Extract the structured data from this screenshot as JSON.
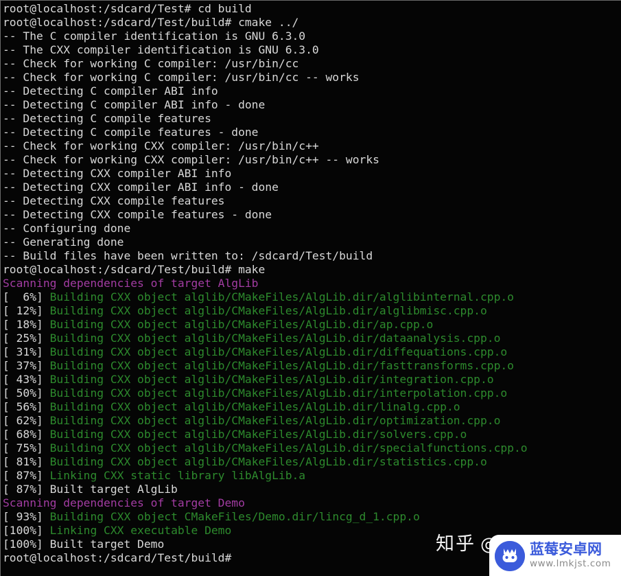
{
  "terminal": {
    "title": "root@localhost:/sdcard/Test/build",
    "colors": {
      "background": "#050505",
      "foreground": "#d8d8d8",
      "green": "#2d8a2d",
      "magenta": "#a23ca2",
      "border": "#6a6a6a"
    },
    "lines": [
      {
        "segments": [
          {
            "text": "root@localhost:/sdcard/Test# cd build",
            "color": "white"
          }
        ]
      },
      {
        "segments": [
          {
            "text": "root@localhost:/sdcard/Test/build# cmake ../",
            "color": "white"
          }
        ]
      },
      {
        "segments": [
          {
            "text": "-- The C compiler identification is GNU 6.3.0",
            "color": "white"
          }
        ]
      },
      {
        "segments": [
          {
            "text": "-- The CXX compiler identification is GNU 6.3.0",
            "color": "white"
          }
        ]
      },
      {
        "segments": [
          {
            "text": "-- Check for working C compiler: /usr/bin/cc",
            "color": "white"
          }
        ]
      },
      {
        "segments": [
          {
            "text": "-- Check for working C compiler: /usr/bin/cc -- works",
            "color": "white"
          }
        ]
      },
      {
        "segments": [
          {
            "text": "-- Detecting C compiler ABI info",
            "color": "white"
          }
        ]
      },
      {
        "segments": [
          {
            "text": "-- Detecting C compiler ABI info - done",
            "color": "white"
          }
        ]
      },
      {
        "segments": [
          {
            "text": "-- Detecting C compile features",
            "color": "white"
          }
        ]
      },
      {
        "segments": [
          {
            "text": "-- Detecting C compile features - done",
            "color": "white"
          }
        ]
      },
      {
        "segments": [
          {
            "text": "-- Check for working CXX compiler: /usr/bin/c++",
            "color": "white"
          }
        ]
      },
      {
        "segments": [
          {
            "text": "-- Check for working CXX compiler: /usr/bin/c++ -- works",
            "color": "white"
          }
        ]
      },
      {
        "segments": [
          {
            "text": "-- Detecting CXX compiler ABI info",
            "color": "white"
          }
        ]
      },
      {
        "segments": [
          {
            "text": "-- Detecting CXX compiler ABI info - done",
            "color": "white"
          }
        ]
      },
      {
        "segments": [
          {
            "text": "-- Detecting CXX compile features",
            "color": "white"
          }
        ]
      },
      {
        "segments": [
          {
            "text": "-- Detecting CXX compile features - done",
            "color": "white"
          }
        ]
      },
      {
        "segments": [
          {
            "text": "-- Configuring done",
            "color": "white"
          }
        ]
      },
      {
        "segments": [
          {
            "text": "-- Generating done",
            "color": "white"
          }
        ]
      },
      {
        "segments": [
          {
            "text": "-- Build files have been written to: /sdcard/Test/build",
            "color": "white"
          }
        ]
      },
      {
        "segments": [
          {
            "text": "root@localhost:/sdcard/Test/build# make",
            "color": "white"
          }
        ]
      },
      {
        "segments": [
          {
            "text": "Scanning dependencies of target AlgLib",
            "color": "magenta"
          }
        ]
      },
      {
        "segments": [
          {
            "text": "[  6%] ",
            "color": "white"
          },
          {
            "text": "Building CXX object alglib/CMakeFiles/AlgLib.dir/alglibinternal.cpp.o",
            "color": "green"
          }
        ]
      },
      {
        "segments": [
          {
            "text": "[ 12%] ",
            "color": "white"
          },
          {
            "text": "Building CXX object alglib/CMakeFiles/AlgLib.dir/alglibmisc.cpp.o",
            "color": "green"
          }
        ]
      },
      {
        "segments": [
          {
            "text": "[ 18%] ",
            "color": "white"
          },
          {
            "text": "Building CXX object alglib/CMakeFiles/AlgLib.dir/ap.cpp.o",
            "color": "green"
          }
        ]
      },
      {
        "segments": [
          {
            "text": "[ 25%] ",
            "color": "white"
          },
          {
            "text": "Building CXX object alglib/CMakeFiles/AlgLib.dir/dataanalysis.cpp.o",
            "color": "green"
          }
        ]
      },
      {
        "segments": [
          {
            "text": "[ 31%] ",
            "color": "white"
          },
          {
            "text": "Building CXX object alglib/CMakeFiles/AlgLib.dir/diffequations.cpp.o",
            "color": "green"
          }
        ]
      },
      {
        "segments": [
          {
            "text": "[ 37%] ",
            "color": "white"
          },
          {
            "text": "Building CXX object alglib/CMakeFiles/AlgLib.dir/fasttransforms.cpp.o",
            "color": "green"
          }
        ]
      },
      {
        "segments": [
          {
            "text": "[ 43%] ",
            "color": "white"
          },
          {
            "text": "Building CXX object alglib/CMakeFiles/AlgLib.dir/integration.cpp.o",
            "color": "green"
          }
        ]
      },
      {
        "segments": [
          {
            "text": "[ 50%] ",
            "color": "white"
          },
          {
            "text": "Building CXX object alglib/CMakeFiles/AlgLib.dir/interpolation.cpp.o",
            "color": "green"
          }
        ]
      },
      {
        "segments": [
          {
            "text": "[ 56%] ",
            "color": "white"
          },
          {
            "text": "Building CXX object alglib/CMakeFiles/AlgLib.dir/linalg.cpp.o",
            "color": "green"
          }
        ]
      },
      {
        "segments": [
          {
            "text": "[ 62%] ",
            "color": "white"
          },
          {
            "text": "Building CXX object alglib/CMakeFiles/AlgLib.dir/optimization.cpp.o",
            "color": "green"
          }
        ]
      },
      {
        "segments": [
          {
            "text": "[ 68%] ",
            "color": "white"
          },
          {
            "text": "Building CXX object alglib/CMakeFiles/AlgLib.dir/solvers.cpp.o",
            "color": "green"
          }
        ]
      },
      {
        "segments": [
          {
            "text": "[ 75%] ",
            "color": "white"
          },
          {
            "text": "Building CXX object alglib/CMakeFiles/AlgLib.dir/specialfunctions.cpp.o",
            "color": "green"
          }
        ]
      },
      {
        "segments": [
          {
            "text": "[ 81%] ",
            "color": "white"
          },
          {
            "text": "Building CXX object alglib/CMakeFiles/AlgLib.dir/statistics.cpp.o",
            "color": "green"
          }
        ]
      },
      {
        "segments": [
          {
            "text": "[ 87%] ",
            "color": "white"
          },
          {
            "text": "Linking CXX static library libAlgLib.a",
            "color": "green"
          }
        ]
      },
      {
        "segments": [
          {
            "text": "[ 87%] Built target AlgLib",
            "color": "white"
          }
        ]
      },
      {
        "segments": [
          {
            "text": "Scanning dependencies of target Demo",
            "color": "magenta"
          }
        ]
      },
      {
        "segments": [
          {
            "text": "[ 93%] ",
            "color": "white"
          },
          {
            "text": "Building CXX object CMakeFiles/Demo.dir/lincg_d_1.cpp.o",
            "color": "green"
          }
        ]
      },
      {
        "segments": [
          {
            "text": "[100%] ",
            "color": "white"
          },
          {
            "text": "Linking CXX executable Demo",
            "color": "green"
          }
        ]
      },
      {
        "segments": [
          {
            "text": "[100%] Built target Demo",
            "color": "white"
          }
        ]
      },
      {
        "segments": [
          {
            "text": "root@localhost:/sdcard/Test/build#",
            "color": "white"
          }
        ]
      }
    ]
  },
  "watermarks": {
    "zhihu": {
      "label": "知乎",
      "at_symbol": "@"
    },
    "site": {
      "name": "蓝莓安卓网",
      "url": "www.lmkjst.com",
      "logo_color": "#3b5bdb"
    }
  }
}
